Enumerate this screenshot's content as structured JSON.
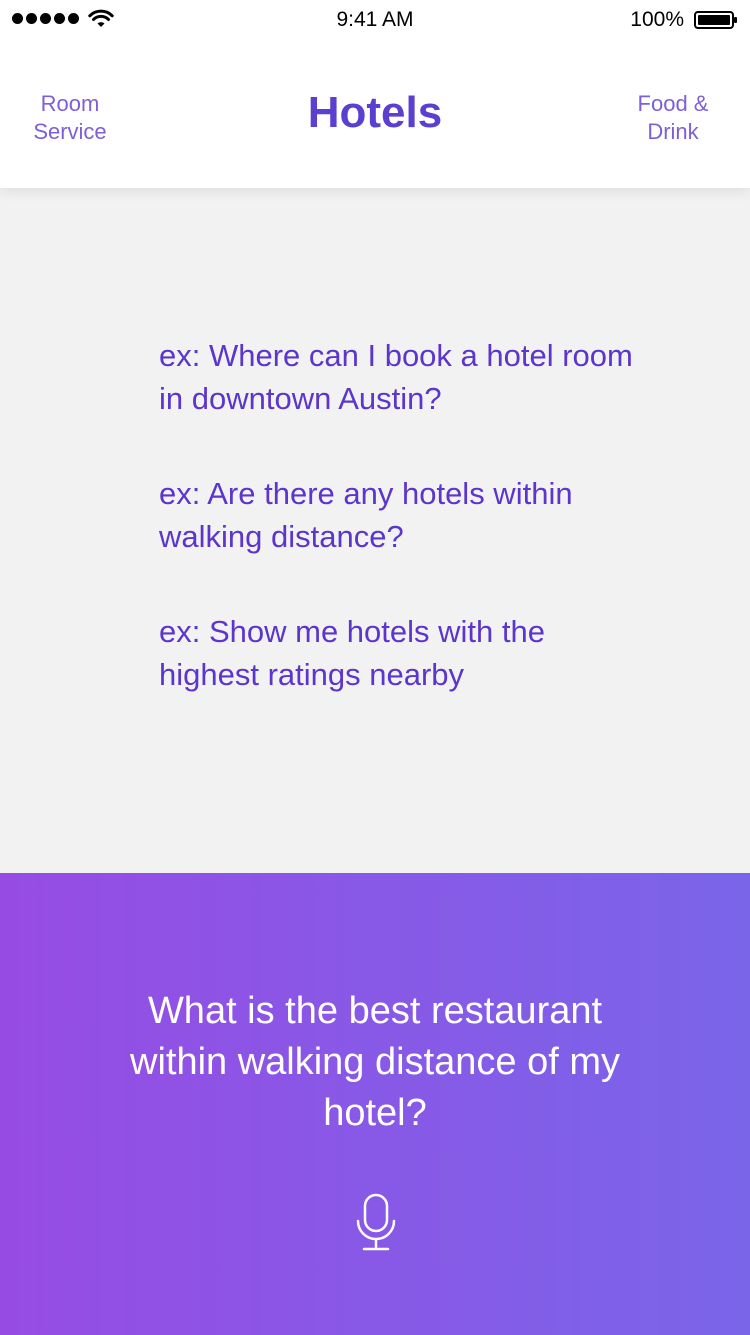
{
  "status_bar": {
    "time": "9:41 AM",
    "battery_percent": "100%",
    "signal_bars": 5
  },
  "header": {
    "left_nav": "Room\nService",
    "title": "Hotels",
    "right_nav": "Food &\nDrink"
  },
  "examples": [
    "ex: Where can I book a hotel room in downtown Austin?",
    "ex: Are there any hotels within walking distance?",
    "ex: Show me hotels with the highest ratings nearby"
  ],
  "voice": {
    "query": "What is the best restaurant within walking distance of my hotel?",
    "icon": "microphone-icon"
  },
  "colors": {
    "accent": "#5b3fd0",
    "nav": "#7e5fd8",
    "gradient_start": "#964ce3",
    "gradient_end": "#7a65e9",
    "background": "#f2f2f2"
  }
}
